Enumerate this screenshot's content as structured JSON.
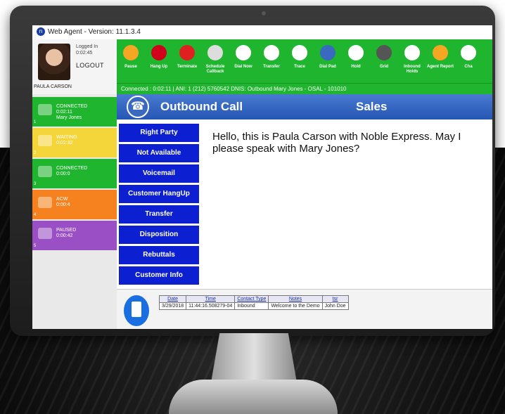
{
  "window": {
    "title": "Web Agent - Version: 11.1.3.4"
  },
  "agent": {
    "logged_in_label": "Logged In",
    "logged_in_time": "0:02:45",
    "logout_label": "LOGOUT",
    "name": "PAULA CARSON"
  },
  "toolbar": [
    {
      "label": "Pause",
      "icon": "pause-icon",
      "color": "#f5a623"
    },
    {
      "label": "Hang Up",
      "icon": "hang-up-icon",
      "color": "#d0021b"
    },
    {
      "label": "Terminate",
      "icon": "terminate-icon",
      "color": "#e02020"
    },
    {
      "label": "Schedule Callback",
      "icon": "schedule-callback-icon",
      "color": "#dddddd"
    },
    {
      "label": "Dial Now",
      "icon": "dial-now-icon",
      "color": "#ffffff"
    },
    {
      "label": "Transfer",
      "icon": "transfer-icon",
      "color": "#ffffff"
    },
    {
      "label": "Trace",
      "icon": "trace-icon",
      "color": "#ffffff"
    },
    {
      "label": "Dial Pad",
      "icon": "dial-pad-icon",
      "color": "#3a6ac0"
    },
    {
      "label": "Hold",
      "icon": "hold-icon",
      "color": "#ffffff"
    },
    {
      "label": "Grid",
      "icon": "grid-icon",
      "color": "#555555"
    },
    {
      "label": "Inbound Holds",
      "icon": "inbound-holds-icon",
      "color": "#ffffff"
    },
    {
      "label": "Agent Report",
      "icon": "agent-report-icon",
      "color": "#f5a623"
    },
    {
      "label": "Cha",
      "icon": "chat-icon",
      "color": "#ffffff"
    }
  ],
  "status_line": "Connected  :  0:02:11   |   ANI: 1 (212) 5760542   DNIS: Outbound   Mary Jones - OSAL - 101010",
  "states": [
    {
      "status": "CONNECTED",
      "time": "0:02:11",
      "detail": "Mary Jones",
      "index": "1",
      "color": "#1fb52f",
      "icon": "phone-icon"
    },
    {
      "status": "WAITING",
      "time": "0:02:32",
      "detail": "",
      "index": "2",
      "color": "#f4d53a",
      "icon": "chat-bubble-icon"
    },
    {
      "status": "CONNECTED",
      "time": "0:00:0",
      "detail": "",
      "index": "3",
      "color": "#1fb52f",
      "icon": "sms-icon"
    },
    {
      "status": "ACW",
      "time": "0:00:4",
      "detail": "",
      "index": "4",
      "color": "#f5821f",
      "icon": "email-icon"
    },
    {
      "status": "PAUSED",
      "time": "0:00:42",
      "detail": "",
      "index": "5",
      "color": "#9b4fc4",
      "icon": "sms-icon"
    }
  ],
  "call": {
    "type": "Outbound Call",
    "campaign": "Sales"
  },
  "script_buttons": [
    "Right Party",
    "Not Available",
    "Voicemail",
    "Customer HangUp",
    "Transfer",
    "Disposition",
    "Rebuttals",
    "Customer Info"
  ],
  "script_text": "Hello, this is Paula Carson with Noble Express.  May I please speak with Mary Jones?",
  "history": {
    "columns": [
      "Date",
      "Time",
      "Contact Type",
      "Notes",
      "tsr"
    ],
    "rows": [
      [
        "3/29/2018",
        "11:44:16.508279-04",
        "Inbound",
        "Welcome to the Demo",
        "John Doe"
      ]
    ]
  }
}
